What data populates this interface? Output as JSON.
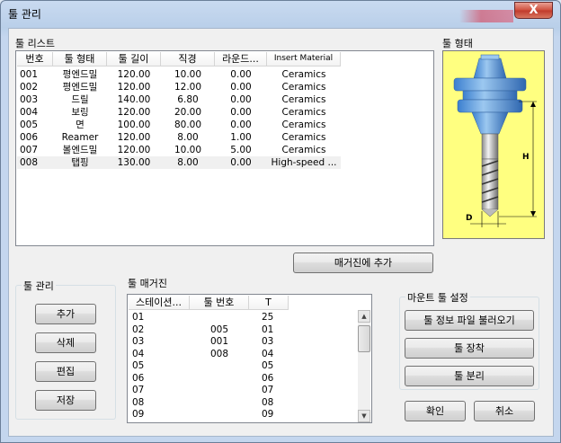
{
  "window": {
    "title": "툴 관리",
    "close_label": "X"
  },
  "tool_list": {
    "label": "툴 리스트",
    "columns": [
      "번호",
      "툴 형태",
      "툴 길이",
      "직경",
      "라운드...",
      "Insert Material"
    ],
    "rows": [
      [
        "001",
        "평엔드밀",
        "120.00",
        "10.00",
        "0.00",
        "Ceramics"
      ],
      [
        "002",
        "평엔드밀",
        "120.00",
        "12.00",
        "0.00",
        "Ceramics"
      ],
      [
        "003",
        "드릴",
        "140.00",
        "6.80",
        "0.00",
        "Ceramics"
      ],
      [
        "004",
        "보링",
        "120.00",
        "20.00",
        "0.00",
        "Ceramics"
      ],
      [
        "005",
        "면",
        "100.00",
        "80.00",
        "0.00",
        "Ceramics"
      ],
      [
        "006",
        "Reamer",
        "120.00",
        "8.00",
        "1.00",
        "Ceramics"
      ],
      [
        "007",
        "볼엔드밀",
        "120.00",
        "10.00",
        "5.00",
        "Ceramics"
      ],
      [
        "008",
        "탭핑",
        "130.00",
        "8.00",
        "0.00",
        "High-speed ..."
      ]
    ]
  },
  "tool_shape": {
    "label": "툴 형태",
    "h_label": "H",
    "d_label": "D"
  },
  "add_to_magazine_label": "매거진에 추가",
  "tool_mgmt": {
    "label": "툴 관리",
    "buttons": [
      "추가",
      "삭제",
      "편집",
      "저장"
    ]
  },
  "magazine": {
    "label": "툴 매거진",
    "columns": [
      "스테이션...",
      "툴 번호",
      "T"
    ],
    "rows": [
      [
        "01",
        "",
        "25"
      ],
      [
        "02",
        "005",
        "01"
      ],
      [
        "03",
        "001",
        "03"
      ],
      [
        "04",
        "008",
        "04"
      ],
      [
        "05",
        "",
        "05"
      ],
      [
        "06",
        "",
        "06"
      ],
      [
        "07",
        "",
        "07"
      ],
      [
        "08",
        "",
        "08"
      ],
      [
        "09",
        "",
        "09"
      ]
    ]
  },
  "mount": {
    "label": "마운트 툴 설정",
    "buttons": [
      "툴 정보 파일 불러오기",
      "툴 장착",
      "툴 분리"
    ]
  },
  "ok_label": "확인",
  "cancel_label": "취소"
}
